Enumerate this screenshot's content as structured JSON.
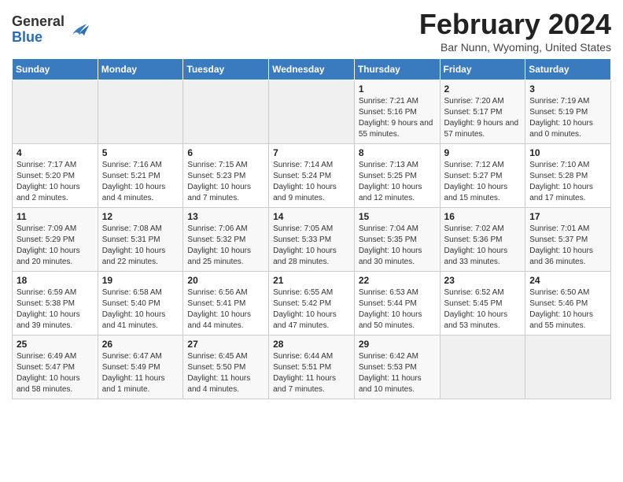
{
  "header": {
    "logo_general": "General",
    "logo_blue": "Blue",
    "month_title": "February 2024",
    "location": "Bar Nunn, Wyoming, United States"
  },
  "weekdays": [
    "Sunday",
    "Monday",
    "Tuesday",
    "Wednesday",
    "Thursday",
    "Friday",
    "Saturday"
  ],
  "weeks": [
    [
      {
        "day": "",
        "info": ""
      },
      {
        "day": "",
        "info": ""
      },
      {
        "day": "",
        "info": ""
      },
      {
        "day": "",
        "info": ""
      },
      {
        "day": "1",
        "info": "Sunrise: 7:21 AM\nSunset: 5:16 PM\nDaylight: 9 hours and 55 minutes."
      },
      {
        "day": "2",
        "info": "Sunrise: 7:20 AM\nSunset: 5:17 PM\nDaylight: 9 hours and 57 minutes."
      },
      {
        "day": "3",
        "info": "Sunrise: 7:19 AM\nSunset: 5:19 PM\nDaylight: 10 hours and 0 minutes."
      }
    ],
    [
      {
        "day": "4",
        "info": "Sunrise: 7:17 AM\nSunset: 5:20 PM\nDaylight: 10 hours and 2 minutes."
      },
      {
        "day": "5",
        "info": "Sunrise: 7:16 AM\nSunset: 5:21 PM\nDaylight: 10 hours and 4 minutes."
      },
      {
        "day": "6",
        "info": "Sunrise: 7:15 AM\nSunset: 5:23 PM\nDaylight: 10 hours and 7 minutes."
      },
      {
        "day": "7",
        "info": "Sunrise: 7:14 AM\nSunset: 5:24 PM\nDaylight: 10 hours and 9 minutes."
      },
      {
        "day": "8",
        "info": "Sunrise: 7:13 AM\nSunset: 5:25 PM\nDaylight: 10 hours and 12 minutes."
      },
      {
        "day": "9",
        "info": "Sunrise: 7:12 AM\nSunset: 5:27 PM\nDaylight: 10 hours and 15 minutes."
      },
      {
        "day": "10",
        "info": "Sunrise: 7:10 AM\nSunset: 5:28 PM\nDaylight: 10 hours and 17 minutes."
      }
    ],
    [
      {
        "day": "11",
        "info": "Sunrise: 7:09 AM\nSunset: 5:29 PM\nDaylight: 10 hours and 20 minutes."
      },
      {
        "day": "12",
        "info": "Sunrise: 7:08 AM\nSunset: 5:31 PM\nDaylight: 10 hours and 22 minutes."
      },
      {
        "day": "13",
        "info": "Sunrise: 7:06 AM\nSunset: 5:32 PM\nDaylight: 10 hours and 25 minutes."
      },
      {
        "day": "14",
        "info": "Sunrise: 7:05 AM\nSunset: 5:33 PM\nDaylight: 10 hours and 28 minutes."
      },
      {
        "day": "15",
        "info": "Sunrise: 7:04 AM\nSunset: 5:35 PM\nDaylight: 10 hours and 30 minutes."
      },
      {
        "day": "16",
        "info": "Sunrise: 7:02 AM\nSunset: 5:36 PM\nDaylight: 10 hours and 33 minutes."
      },
      {
        "day": "17",
        "info": "Sunrise: 7:01 AM\nSunset: 5:37 PM\nDaylight: 10 hours and 36 minutes."
      }
    ],
    [
      {
        "day": "18",
        "info": "Sunrise: 6:59 AM\nSunset: 5:38 PM\nDaylight: 10 hours and 39 minutes."
      },
      {
        "day": "19",
        "info": "Sunrise: 6:58 AM\nSunset: 5:40 PM\nDaylight: 10 hours and 41 minutes."
      },
      {
        "day": "20",
        "info": "Sunrise: 6:56 AM\nSunset: 5:41 PM\nDaylight: 10 hours and 44 minutes."
      },
      {
        "day": "21",
        "info": "Sunrise: 6:55 AM\nSunset: 5:42 PM\nDaylight: 10 hours and 47 minutes."
      },
      {
        "day": "22",
        "info": "Sunrise: 6:53 AM\nSunset: 5:44 PM\nDaylight: 10 hours and 50 minutes."
      },
      {
        "day": "23",
        "info": "Sunrise: 6:52 AM\nSunset: 5:45 PM\nDaylight: 10 hours and 53 minutes."
      },
      {
        "day": "24",
        "info": "Sunrise: 6:50 AM\nSunset: 5:46 PM\nDaylight: 10 hours and 55 minutes."
      }
    ],
    [
      {
        "day": "25",
        "info": "Sunrise: 6:49 AM\nSunset: 5:47 PM\nDaylight: 10 hours and 58 minutes."
      },
      {
        "day": "26",
        "info": "Sunrise: 6:47 AM\nSunset: 5:49 PM\nDaylight: 11 hours and 1 minute."
      },
      {
        "day": "27",
        "info": "Sunrise: 6:45 AM\nSunset: 5:50 PM\nDaylight: 11 hours and 4 minutes."
      },
      {
        "day": "28",
        "info": "Sunrise: 6:44 AM\nSunset: 5:51 PM\nDaylight: 11 hours and 7 minutes."
      },
      {
        "day": "29",
        "info": "Sunrise: 6:42 AM\nSunset: 5:53 PM\nDaylight: 11 hours and 10 minutes."
      },
      {
        "day": "",
        "info": ""
      },
      {
        "day": "",
        "info": ""
      }
    ]
  ]
}
